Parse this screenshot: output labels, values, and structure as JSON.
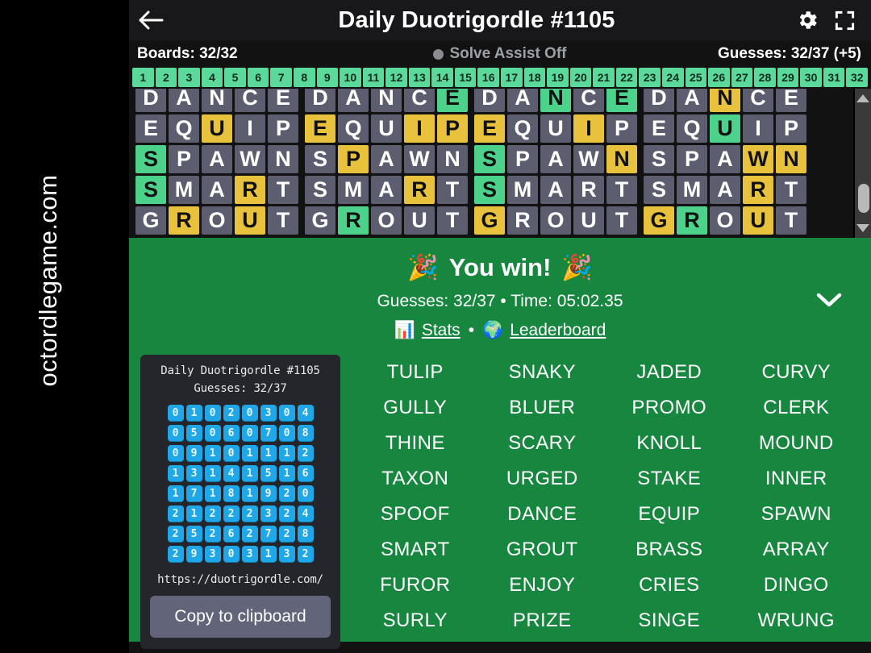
{
  "watermark": {
    "text": "octordlegame.com"
  },
  "header": {
    "back_icon": "arrow-left-icon",
    "title": "Daily Duotrigordle #1105",
    "settings_icon": "gear-icon",
    "fullscreen_icon": "fullscreen-icon"
  },
  "status": {
    "boards": "Boards: 32/32",
    "solve_assist": "Solve Assist Off",
    "guesses": "Guesses: 32/37 (+5)"
  },
  "board_numbers": [
    "1",
    "2",
    "3",
    "4",
    "5",
    "6",
    "7",
    "8",
    "9",
    "10",
    "11",
    "12",
    "13",
    "14",
    "15",
    "16",
    "17",
    "18",
    "19",
    "20",
    "21",
    "22",
    "23",
    "24",
    "25",
    "26",
    "27",
    "28",
    "29",
    "30",
    "31",
    "32"
  ],
  "boards": [
    {
      "rows": [
        {
          "letters": [
            "D",
            "A",
            "N",
            "C",
            "E"
          ],
          "states": [
            "gray",
            "gray",
            "gray",
            "gray",
            "gray"
          ]
        },
        {
          "letters": [
            "E",
            "Q",
            "U",
            "I",
            "P"
          ],
          "states": [
            "gray",
            "gray",
            "yellow",
            "gray",
            "gray"
          ]
        },
        {
          "letters": [
            "S",
            "P",
            "A",
            "W",
            "N"
          ],
          "states": [
            "green",
            "gray",
            "gray",
            "gray",
            "gray"
          ]
        },
        {
          "letters": [
            "S",
            "M",
            "A",
            "R",
            "T"
          ],
          "states": [
            "green",
            "gray",
            "gray",
            "yellow",
            "gray"
          ]
        },
        {
          "letters": [
            "G",
            "R",
            "O",
            "U",
            "T"
          ],
          "states": [
            "gray",
            "yellow",
            "gray",
            "yellow",
            "gray"
          ]
        }
      ]
    },
    {
      "rows": [
        {
          "letters": [
            "D",
            "A",
            "N",
            "C",
            "E"
          ],
          "states": [
            "gray",
            "gray",
            "gray",
            "gray",
            "green"
          ]
        },
        {
          "letters": [
            "E",
            "Q",
            "U",
            "I",
            "P"
          ],
          "states": [
            "yellow",
            "gray",
            "gray",
            "yellow",
            "yellow"
          ]
        },
        {
          "letters": [
            "S",
            "P",
            "A",
            "W",
            "N"
          ],
          "states": [
            "gray",
            "yellow",
            "gray",
            "gray",
            "gray"
          ]
        },
        {
          "letters": [
            "S",
            "M",
            "A",
            "R",
            "T"
          ],
          "states": [
            "gray",
            "gray",
            "gray",
            "yellow",
            "gray"
          ]
        },
        {
          "letters": [
            "G",
            "R",
            "O",
            "U",
            "T"
          ],
          "states": [
            "gray",
            "green",
            "gray",
            "gray",
            "gray"
          ]
        }
      ]
    },
    {
      "rows": [
        {
          "letters": [
            "D",
            "A",
            "N",
            "C",
            "E"
          ],
          "states": [
            "gray",
            "gray",
            "green",
            "gray",
            "green"
          ]
        },
        {
          "letters": [
            "E",
            "Q",
            "U",
            "I",
            "P"
          ],
          "states": [
            "yellow",
            "gray",
            "gray",
            "yellow",
            "gray"
          ]
        },
        {
          "letters": [
            "S",
            "P",
            "A",
            "W",
            "N"
          ],
          "states": [
            "green",
            "gray",
            "gray",
            "gray",
            "yellow"
          ]
        },
        {
          "letters": [
            "S",
            "M",
            "A",
            "R",
            "T"
          ],
          "states": [
            "green",
            "gray",
            "gray",
            "gray",
            "gray"
          ]
        },
        {
          "letters": [
            "G",
            "R",
            "O",
            "U",
            "T"
          ],
          "states": [
            "yellow",
            "gray",
            "gray",
            "gray",
            "gray"
          ]
        }
      ]
    },
    {
      "rows": [
        {
          "letters": [
            "D",
            "A",
            "N",
            "C",
            "E"
          ],
          "states": [
            "gray",
            "gray",
            "yellow",
            "gray",
            "gray"
          ]
        },
        {
          "letters": [
            "E",
            "Q",
            "U",
            "I",
            "P"
          ],
          "states": [
            "gray",
            "gray",
            "green",
            "gray",
            "gray"
          ]
        },
        {
          "letters": [
            "S",
            "P",
            "A",
            "W",
            "N"
          ],
          "states": [
            "gray",
            "gray",
            "gray",
            "yellow",
            "yellow"
          ]
        },
        {
          "letters": [
            "S",
            "M",
            "A",
            "R",
            "T"
          ],
          "states": [
            "gray",
            "gray",
            "gray",
            "yellow",
            "gray"
          ]
        },
        {
          "letters": [
            "G",
            "R",
            "O",
            "U",
            "T"
          ],
          "states": [
            "yellow",
            "green",
            "gray",
            "yellow",
            "gray"
          ]
        }
      ]
    }
  ],
  "scrollbar": {
    "up_icon": "scroll-up-arrow-icon",
    "down_icon": "scroll-down-arrow-icon"
  },
  "banner": {
    "confetti_left": "🎉",
    "confetti_right": "🎉",
    "win_text": "You win!",
    "summary": "Guesses: 32/37 • Time: 05:02.35",
    "stats_icon": "📊",
    "stats_label": "Stats",
    "separator": "•",
    "leaderboard_icon": "🌍",
    "leaderboard_label": "Leaderboard",
    "collapse_icon": "chevron-down-icon"
  },
  "share_card": {
    "title": "Daily Duotrigordle #1105",
    "guesses": "Guesses: 32/37",
    "emoji_tiles": [
      [
        "0",
        "1"
      ],
      [
        "0",
        "2"
      ],
      [
        "0",
        "3"
      ],
      [
        "0",
        "4"
      ],
      [
        "0",
        "5"
      ],
      [
        "0",
        "6"
      ],
      [
        "0",
        "7"
      ],
      [
        "0",
        "8"
      ],
      [
        "0",
        "9"
      ],
      [
        "1",
        "0"
      ],
      [
        "1",
        "1"
      ],
      [
        "1",
        "2"
      ],
      [
        "1",
        "3"
      ],
      [
        "1",
        "4"
      ],
      [
        "1",
        "5"
      ],
      [
        "1",
        "6"
      ],
      [
        "1",
        "7"
      ],
      [
        "1",
        "8"
      ],
      [
        "1",
        "9"
      ],
      [
        "2",
        "0"
      ],
      [
        "2",
        "1"
      ],
      [
        "2",
        "2"
      ],
      [
        "2",
        "3"
      ],
      [
        "2",
        "4"
      ],
      [
        "2",
        "5"
      ],
      [
        "2",
        "6"
      ],
      [
        "2",
        "7"
      ],
      [
        "2",
        "8"
      ],
      [
        "2",
        "9"
      ],
      [
        "3",
        "0"
      ],
      [
        "3",
        "1"
      ],
      [
        "3",
        "2"
      ]
    ],
    "url": "https://duotrigordle.com/",
    "copy_label": "Copy to clipboard"
  },
  "words": [
    "TULIP",
    "SNAKY",
    "JADED",
    "CURVY",
    "GULLY",
    "BLUER",
    "PROMO",
    "CLERK",
    "THINE",
    "SCARY",
    "KNOLL",
    "MOUND",
    "TAXON",
    "URGED",
    "STAKE",
    "INNER",
    "SPOOF",
    "DANCE",
    "EQUIP",
    "SPAWN",
    "SMART",
    "GROUT",
    "BRASS",
    "ARRAY",
    "FUROR",
    "ENJOY",
    "CRIES",
    "DINGO",
    "SURLY",
    "PRIZE",
    "SINGE",
    "WRUNG"
  ],
  "colors": {
    "green_tile": "#4dd28c",
    "yellow_tile": "#e8c23d",
    "gray_tile": "#5c5e70",
    "banner_green": "#17873f",
    "chip_green": "#5bd99b",
    "emoji_blue": "#1fa7e8",
    "app_bg": "#121213"
  }
}
